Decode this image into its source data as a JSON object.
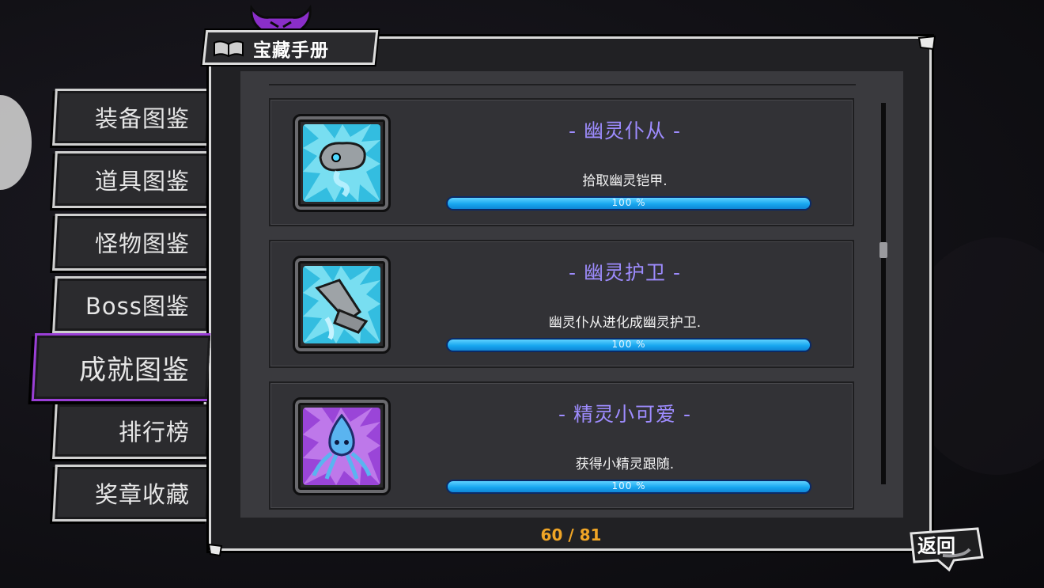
{
  "header": {
    "title": "宝藏手册"
  },
  "menu": [
    {
      "label": "装备图鉴",
      "active": false
    },
    {
      "label": "道具图鉴",
      "active": false
    },
    {
      "label": "怪物图鉴",
      "active": false
    },
    {
      "label": "Boss图鉴",
      "active": false
    },
    {
      "label": "成就图鉴",
      "active": true
    },
    {
      "label": "排行榜",
      "active": false
    },
    {
      "label": "奖章收藏",
      "active": false
    }
  ],
  "achievements": [
    {
      "title": "- 幽灵仆从 -",
      "description": "拾取幽灵铠甲.",
      "progress_label": "100 %",
      "progress": 1.0,
      "icon": "ghost-armor-icon",
      "frame_color": "#35c6e6"
    },
    {
      "title": "- 幽灵护卫 -",
      "description": "幽灵仆从进化成幽灵护卫.",
      "progress_label": "100 %",
      "progress": 1.0,
      "icon": "ghost-guard-icon",
      "frame_color": "#35c6e6"
    },
    {
      "title": "- 精灵小可爱 -",
      "description": "获得小精灵跟随.",
      "progress_label": "100 %",
      "progress": 1.0,
      "icon": "spirit-icon",
      "frame_color": "#a24de0"
    }
  ],
  "pagination": {
    "text": "60 / 81"
  },
  "back_button": {
    "label": "返回"
  },
  "colors": {
    "title": "#9e8cff",
    "active_tab": "#9a3fd6",
    "count": "#f0a526",
    "bar": "#18a7ef"
  }
}
